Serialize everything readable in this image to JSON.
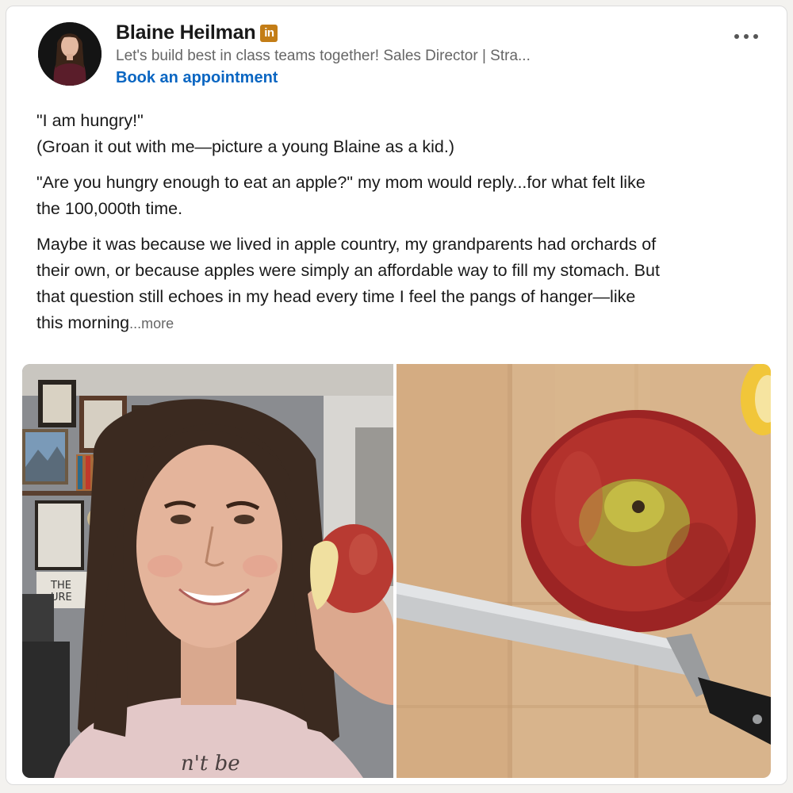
{
  "author": {
    "name": "Blaine Heilman",
    "badge": "in",
    "headline": "Let's build best in class teams together! Sales Director | Stra...",
    "cta_link": "Book an appointment"
  },
  "post": {
    "paragraphs": [
      [
        "\"I am hungry!\"",
        "(Groan it out with me—picture a young Blaine as a kid.)"
      ],
      [
        "\"Are you hungry enough to eat an apple?\" my mom would reply...for what felt like",
        "the 100,000th time."
      ],
      [
        "Maybe it was because we lived in apple country, my grandparents had orchards of",
        "their own, or because apples were simply an affordable way to fill my stomach. But",
        "that question still echoes in my head every time I feel the pangs of hanger—like",
        "this morning"
      ]
    ],
    "see_more": "...more"
  },
  "media": {
    "shirt_text": "n't be",
    "poster_text": "THE FUTURE"
  },
  "icons": [
    "more-options-icon",
    "linkedin-badge-icon"
  ],
  "colors": {
    "link": "#0a66c2",
    "badge": "#c37d16",
    "secondary_text": "#666666"
  }
}
